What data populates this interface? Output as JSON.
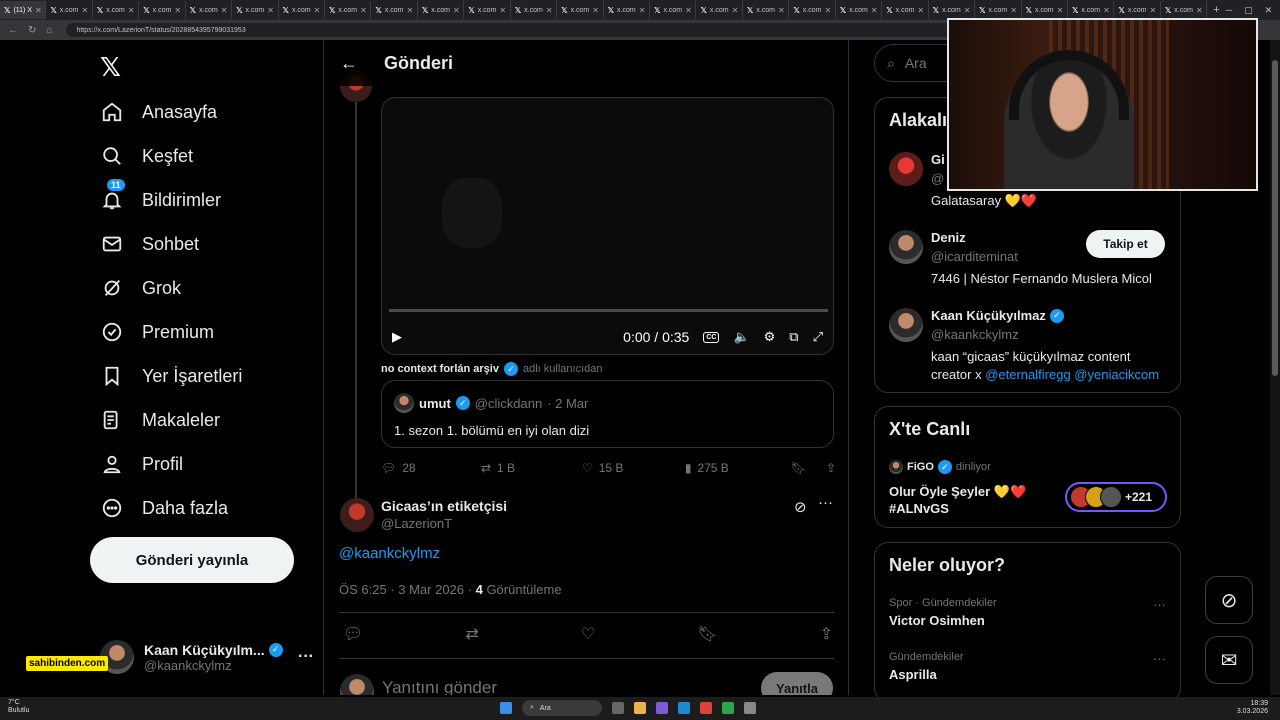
{
  "browser": {
    "active_tab": "(11) X",
    "tab_label": "x.com",
    "tab_count": 26,
    "url": "https://x.com/LazerionT/status/2028854395799031953"
  },
  "leftnav": {
    "items": [
      {
        "label": "Anasayfa",
        "icon": "home-icon"
      },
      {
        "label": "Keşfet",
        "icon": "search-icon"
      },
      {
        "label": "Bildirimler",
        "icon": "bell-icon",
        "badge": "11"
      },
      {
        "label": "Sohbet",
        "icon": "mail-icon"
      },
      {
        "label": "Grok",
        "icon": "grok-icon"
      },
      {
        "label": "Premium",
        "icon": "premium-icon"
      },
      {
        "label": "Yer İşaretleri",
        "icon": "bookmark-icon"
      },
      {
        "label": "Makaleler",
        "icon": "article-icon"
      },
      {
        "label": "Profil",
        "icon": "user-icon"
      },
      {
        "label": "Daha fazla",
        "icon": "more-circle-icon"
      }
    ],
    "post_button": "Gönderi yayınla",
    "profile": {
      "name": "Kaan Küçükyılm...",
      "handle": "@kaankckylmz"
    },
    "sponsor": "sahibinden.com"
  },
  "main": {
    "header_title": "Gönderi",
    "video": {
      "time": "0:00 / 0:35",
      "progress": 0
    },
    "attribution": {
      "name": "no context forlán arşiv",
      "suffix": "adlı kullanıcıdan"
    },
    "quote": {
      "name": "umut",
      "handle": "@clickdann",
      "date": "· 2 Mar",
      "text": "1. sezon 1. bölümü en iyi olan dizi"
    },
    "actions": {
      "replies": "28",
      "reposts": "1 B",
      "likes": "15 B",
      "views": "275 B"
    },
    "post": {
      "name": "Gicaas’ın etiketçisi",
      "handle": "@LazerionT",
      "text": "@kaankckylmz",
      "timestamp": "ÖS 6:25 · 3 Mar 2026 ·",
      "views_count": "4",
      "views_label": "Görüntüleme"
    },
    "reply": {
      "placeholder": "Yanıtını gönder",
      "button": "Yanıtla"
    }
  },
  "right": {
    "search_placeholder": "Ara",
    "related": {
      "title": "Alakalı kişiler",
      "users": [
        {
          "name": "Gi",
          "handle": "@",
          "bio": "Galatasaray 💛❤️"
        },
        {
          "name": "Deniz",
          "handle": "@icarditeminat",
          "bio": "7446 | Néstor Fernando Muslera Micol",
          "follow": "Takip et"
        },
        {
          "name": "Kaan Küçükyılmaz",
          "handle": "@kaankckylmz",
          "bio": "kaan “gicaas” küçükyılmaz content creator x",
          "links": [
            "@eternalfiregg",
            "@yeniacikcom"
          ]
        }
      ]
    },
    "live": {
      "title": "X'te Canlı",
      "host": "FiGO",
      "host_status": "dinliyor",
      "space_title_line1": "Olur Öyle Şeyler 💛❤️",
      "space_title_line2": "#ALNvGS",
      "listener_count": "+221"
    },
    "trending": {
      "title": "Neler oluyor?",
      "items": [
        {
          "category": "Spor · Gündemdekiler",
          "topic": "Victor Osimhen"
        },
        {
          "category": "Gündemdekiler",
          "topic": "Asprilla"
        }
      ]
    }
  },
  "taskbar": {
    "weather_temp": "7°C",
    "weather_desc": "Bulutlu",
    "search": "Ara",
    "time": "18:39",
    "date": "3.03.2026"
  },
  "colors": {
    "accent": "#1d9bf0",
    "live_border": "#7856ff",
    "background": "#000000"
  }
}
